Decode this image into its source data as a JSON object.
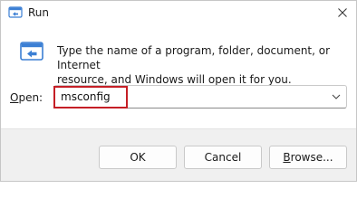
{
  "window": {
    "title": "Run",
    "close_icon": "close-icon"
  },
  "dialog": {
    "description": "Type the name of a program, folder, document, or Internet\nresource, and Windows will open it for you.",
    "open_label_mnemonic": "O",
    "open_label_rest": "pen:",
    "input_value": "msconfig",
    "highlight_color": "#c51f26"
  },
  "buttons": {
    "ok": "OK",
    "cancel": "Cancel",
    "browse_mnemonic": "B",
    "browse_rest": "rowse..."
  }
}
